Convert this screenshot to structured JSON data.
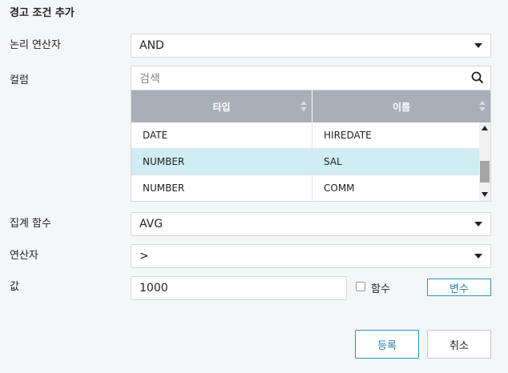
{
  "dialog": {
    "title": "경고 조건 추가"
  },
  "logic": {
    "label": "논리 연산자",
    "value": "AND"
  },
  "column": {
    "label": "컬럼",
    "search_placeholder": "검색",
    "headers": [
      "타입",
      "이름"
    ],
    "rows": [
      {
        "type": "DATE",
        "name": "HIREDATE"
      },
      {
        "type": "NUMBER",
        "name": "SAL"
      },
      {
        "type": "NUMBER",
        "name": "COMM"
      }
    ],
    "selected_row": 1
  },
  "aggregate": {
    "label": "집계 함수",
    "value": "AVG"
  },
  "operator": {
    "label": "연산자",
    "value": ">"
  },
  "value": {
    "label": "값",
    "input": "1000",
    "function_checkbox_label": "함수",
    "function_checked": false,
    "variable_button": "변수"
  },
  "actions": {
    "register": "등록",
    "cancel": "취소"
  },
  "colors": {
    "accent": "#2a92b8",
    "header_bg": "#a9afb9",
    "selected_row_bg": "#cfedf2"
  },
  "icons": {
    "search": "search-icon",
    "dropdown": "caret-down-icon",
    "sort": "sort-icon"
  }
}
